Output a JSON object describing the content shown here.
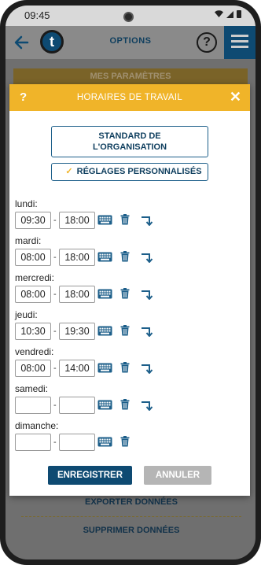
{
  "status_bar": {
    "time": "09:45"
  },
  "header": {
    "title": "OPTIONS",
    "logo_letter": "t",
    "help_label": "?"
  },
  "background": {
    "tab_label": "MES PARAMÈTRES",
    "export_label": "EXPORTER DONNÉES",
    "delete_label": "SUPPRIMER DONNÉES"
  },
  "modal": {
    "help_label": "?",
    "title": "HORAIRES DE TRAVAIL",
    "close_label": "✕",
    "standard_line1": "STANDARD DE",
    "standard_line2": "L'ORGANISATION",
    "custom_check": "✓",
    "custom_label": "RÉGLAGES PERSONNALISÉS",
    "days": [
      {
        "label": "lundi:",
        "start": "09:30",
        "end": "18:00"
      },
      {
        "label": "mardi:",
        "start": "08:00",
        "end": "18:00"
      },
      {
        "label": "mercredi:",
        "start": "08:00",
        "end": "18:00"
      },
      {
        "label": "jeudi:",
        "start": "10:30",
        "end": "19:30"
      },
      {
        "label": "vendredi:",
        "start": "08:00",
        "end": "14:00"
      },
      {
        "label": "samedi:",
        "start": "",
        "end": ""
      },
      {
        "label": "dimanche:",
        "start": "",
        "end": ""
      }
    ],
    "separator": "-",
    "save_label": "ENREGISTRER",
    "cancel_label": "ANNULER"
  },
  "colors": {
    "accent_yellow": "#f0b429",
    "primary_blue": "#0e4a72",
    "cancel_gray": "#b5b5b5"
  }
}
